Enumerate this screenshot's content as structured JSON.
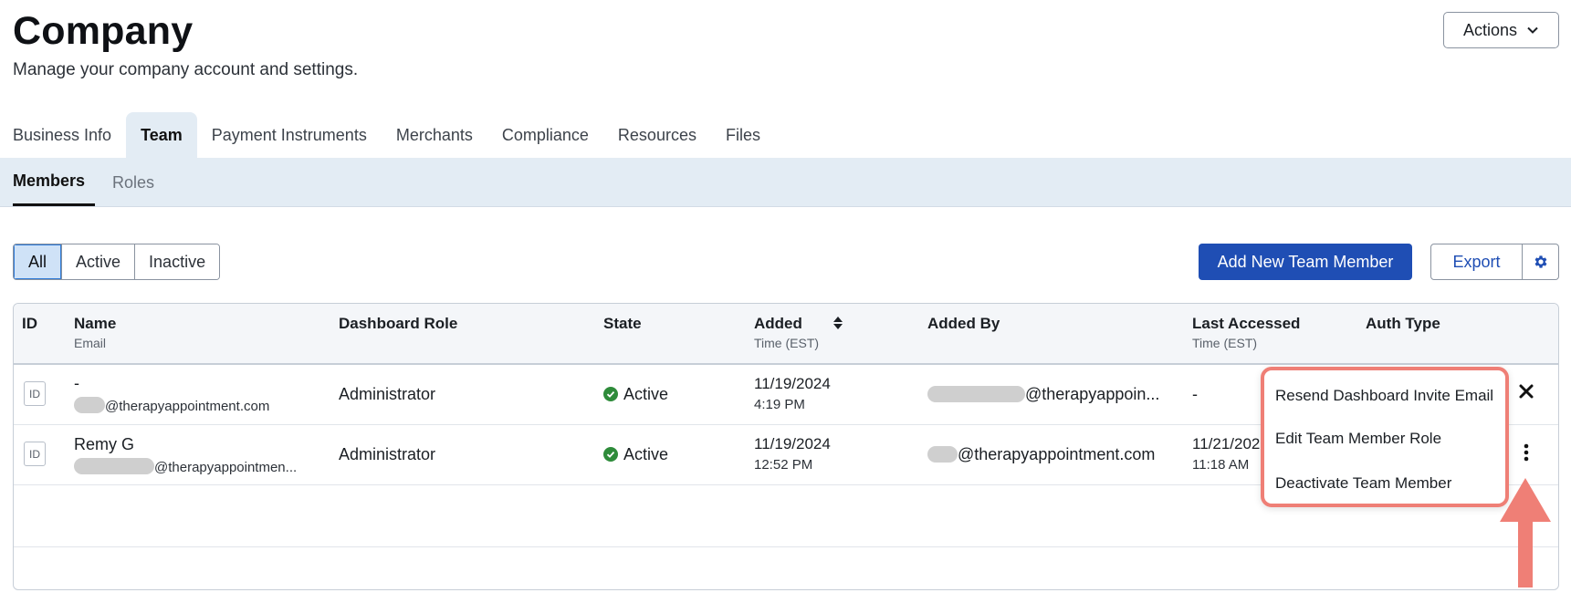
{
  "header": {
    "title": "Company",
    "subtitle": "Manage your company account and settings.",
    "actions_label": "Actions"
  },
  "tabs": [
    {
      "label": "Business Info",
      "active": false
    },
    {
      "label": "Team",
      "active": true
    },
    {
      "label": "Payment Instruments",
      "active": false
    },
    {
      "label": "Merchants",
      "active": false
    },
    {
      "label": "Compliance",
      "active": false
    },
    {
      "label": "Resources",
      "active": false
    },
    {
      "label": "Files",
      "active": false
    }
  ],
  "subtabs": [
    {
      "label": "Members",
      "active": true
    },
    {
      "label": "Roles",
      "active": false
    }
  ],
  "filters": [
    {
      "label": "All",
      "active": true
    },
    {
      "label": "Active",
      "active": false
    },
    {
      "label": "Inactive",
      "active": false
    }
  ],
  "toolbar": {
    "add_label": "Add New Team Member",
    "export_label": "Export"
  },
  "table": {
    "headers": {
      "id": "ID",
      "name": "Name",
      "name_sub": "Email",
      "role": "Dashboard Role",
      "state": "State",
      "added": "Added",
      "added_sub": "Time (EST)",
      "added_by": "Added By",
      "last_accessed": "Last Accessed",
      "last_accessed_sub": "Time (EST)",
      "auth_type": "Auth Type"
    },
    "rows": [
      {
        "id_label": "ID",
        "name": "-",
        "email": "@therapyappointment.com",
        "role": "Administrator",
        "state": "Active",
        "added_date": "11/19/2024",
        "added_time": "4:19 PM",
        "added_by": "@therapyappoin...",
        "last_accessed": "-",
        "last_accessed_time": ""
      },
      {
        "id_label": "ID",
        "name": "Remy G",
        "email": "@therapyappointmen...",
        "role": "Administrator",
        "state": "Active",
        "added_date": "11/19/2024",
        "added_time": "12:52 PM",
        "added_by": "@therapyappointment.com",
        "last_accessed": "11/21/202",
        "last_accessed_time": "11:18 AM"
      }
    ]
  },
  "row_menu": {
    "items": [
      "Resend Dashboard Invite Email",
      "Edit Team Member Role",
      "Deactivate Team Member"
    ]
  },
  "colors": {
    "primary": "#1f4eb4",
    "active_state": "#2e8b3a",
    "highlight": "#ef7f76",
    "subnav_bg": "#e3ecf4"
  },
  "icons": {
    "actions": "chevron-down-icon",
    "settings": "gear-icon",
    "sort": "sort-icon",
    "state": "check-circle-icon",
    "close": "close-icon",
    "more": "kebab-icon",
    "annotation": "arrow-up-icon"
  }
}
